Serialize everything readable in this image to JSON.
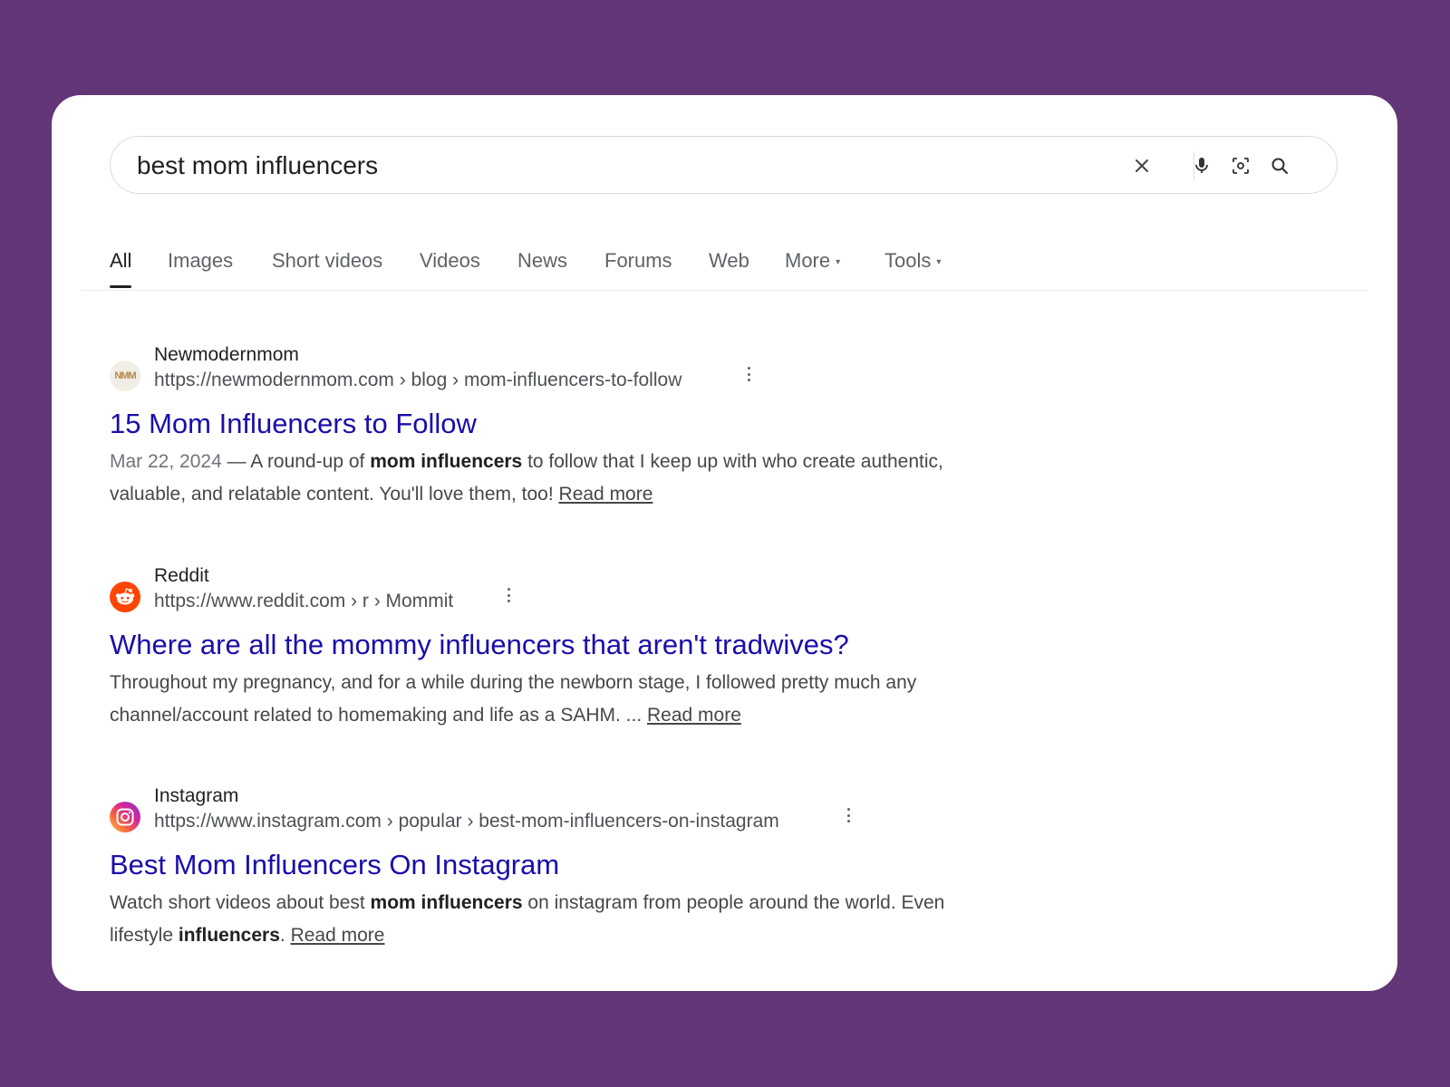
{
  "search": {
    "query": "best mom influencers",
    "icons": [
      "close-icon",
      "microphone-icon",
      "lens-icon",
      "search-icon"
    ]
  },
  "tabs": [
    {
      "label": "All",
      "active": true
    },
    {
      "label": "Images"
    },
    {
      "label": "Short videos"
    },
    {
      "label": "Videos"
    },
    {
      "label": "News"
    },
    {
      "label": "Forums"
    },
    {
      "label": "Web"
    },
    {
      "label": "More",
      "dropdown": true
    },
    {
      "label": "Tools",
      "dropdown": true
    }
  ],
  "results": [
    {
      "site_name": "Newmodernmom",
      "favicon_text": "NMM",
      "url": "https://newmodernmom.com › blog › mom-influencers-to-follow",
      "title": "15 Mom Influencers to Follow",
      "date": "Mar 22, 2024",
      "snippet_parts": [
        " — A round-up of ",
        "mom influencers",
        " to follow that I keep up with who create authentic, valuable, and relatable content. You'll love them, too! "
      ],
      "read_more": "Read more"
    },
    {
      "site_name": "Reddit",
      "url": "https://www.reddit.com › r › Mommit",
      "title": "Where are all the mommy influencers that aren't tradwives?",
      "snippet_parts": [
        "Throughout my pregnancy, and for a while during the newborn stage, I followed pretty much any channel/account related to homemaking and life as a SAHM. ... "
      ],
      "read_more": "Read more"
    },
    {
      "site_name": "Instagram",
      "url": "https://www.instagram.com › popular › best-mom-influencers-on-instagram",
      "title": "Best Mom Influencers On Instagram",
      "snippet_parts": [
        "Watch short videos about best ",
        "mom influencers",
        " on instagram from people around the world. Even lifestyle ",
        "influencers",
        ". "
      ],
      "read_more": "Read more"
    }
  ],
  "colors": {
    "background": "#633677",
    "link": "#1a0dab",
    "reddit": "#ff4500"
  }
}
